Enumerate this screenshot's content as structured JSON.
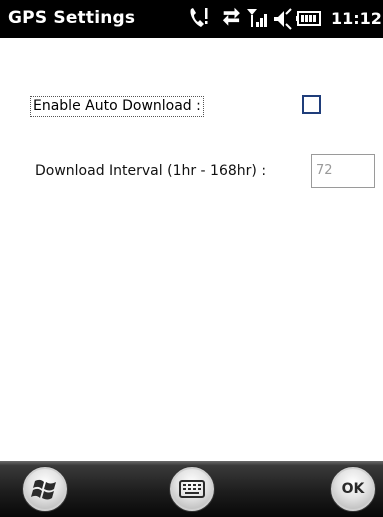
{
  "titlebar": {
    "title": "GPS Settings",
    "time": "11:12",
    "icons": [
      "phone-alert-icon",
      "data-sync-icon",
      "signal-strength-icon",
      "volume-icon",
      "battery-icon"
    ]
  },
  "settings": {
    "auto_download_label": "Enable Auto Download :",
    "auto_download_checked": false,
    "interval_label": "Download Interval (1hr - 168hr) :",
    "interval_value": "72"
  },
  "softkeys": {
    "start_icon": "windows-start-icon",
    "keyboard_icon": "keyboard-icon",
    "ok_label": "OK"
  }
}
